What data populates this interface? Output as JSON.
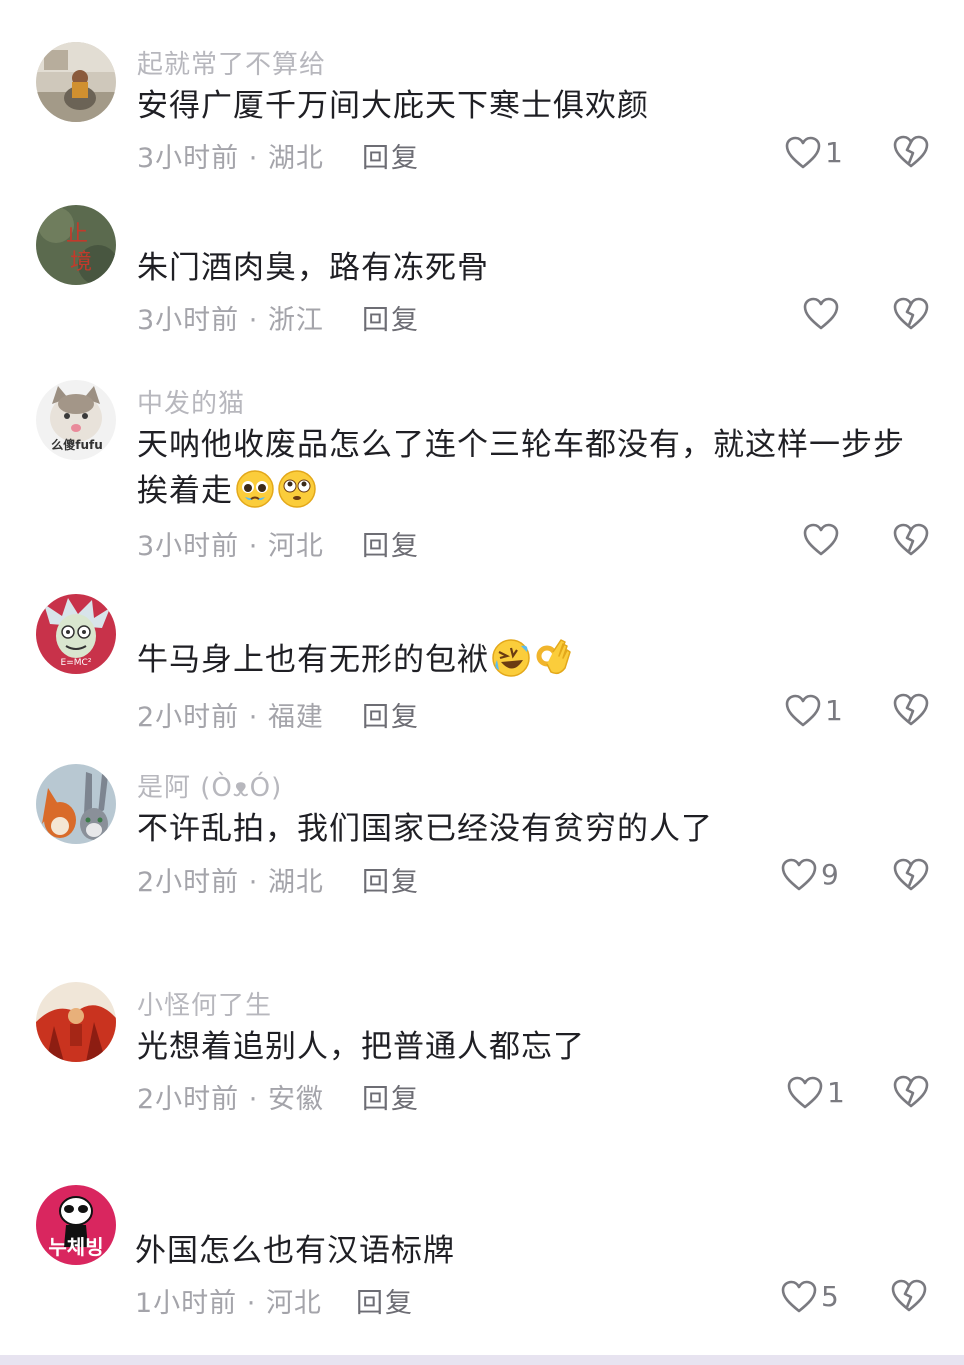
{
  "reply_label": "回复",
  "comments": [
    {
      "username": "起就常了不算给",
      "text": "安得广厦千万间大庇天下寒士俱欢颜",
      "time": "3小时前",
      "location": "湖北",
      "like_count": "1"
    },
    {
      "username": "",
      "text": "朱门酒肉臭，路有冻死骨",
      "time": "3小时前",
      "location": "浙江",
      "like_count": ""
    },
    {
      "username": "中发的猫",
      "text": "天呐他收废品怎么了连个三轮车都没有，就这样一步步挨着走",
      "text_line1": "天呐他收废品怎么了连个三轮车都没有，就这样一步步",
      "text_line2": "挨着走",
      "emojis": [
        "pleading-face-emoji",
        "flushed-face-emoji"
      ],
      "avatar_text": "么傻fufu",
      "time": "3小时前",
      "location": "河北",
      "like_count": ""
    },
    {
      "username": "",
      "text": "牛马身上也有无形的包袱",
      "emojis": [
        "rolling-laughing-emoji",
        "ok-hand-emoji"
      ],
      "avatar_text": "E=MC²",
      "time": "2小时前",
      "location": "福建",
      "like_count": "1"
    },
    {
      "username": "是阿 (ÒᴥÓ)",
      "text": "不许乱拍，我们国家已经没有贫穷的人了",
      "time": "2小时前",
      "location": "湖北",
      "like_count": "9"
    },
    {
      "username": "小怪何了生",
      "text": "光想着追别人，把普通人都忘了",
      "time": "2小时前",
      "location": "安徽",
      "like_count": "1"
    },
    {
      "username": "",
      "text": "外国怎么也有汉语标牌",
      "avatar_text": "누체빙",
      "time": "1小时前",
      "location": "河北",
      "like_count": "5"
    }
  ],
  "colors": {
    "text": "#1f1f24",
    "meta": "#a4a4aa",
    "icon": "#7a7a80"
  }
}
